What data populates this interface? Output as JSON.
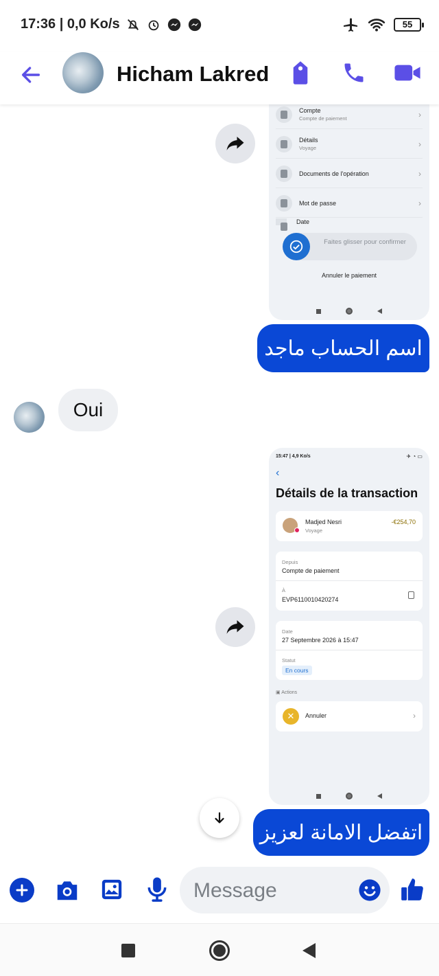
{
  "status_bar": {
    "time_speed": "17:36 | 0,0 Ko/s",
    "battery": "55"
  },
  "header": {
    "contact_name": "Hicham Lakred"
  },
  "shared_screenshot_1": {
    "rows": [
      {
        "title": "Compte",
        "subtitle": "Compte de paiement"
      },
      {
        "title": "Détails",
        "subtitle": "Voyage"
      },
      {
        "title": "Documents de l'opération",
        "subtitle": ""
      },
      {
        "title": "Mot de passe",
        "subtitle": ""
      },
      {
        "title": "Date",
        "subtitle": ""
      }
    ],
    "slide_text": "Faites glisser pour confirmer",
    "cancel_payment": "Annuler le paiement"
  },
  "messages": {
    "outgoing_1": "اسم الحساب ماجد",
    "incoming_1": "Oui",
    "outgoing_2": "اتفضل الامانة لعزيز"
  },
  "shared_screenshot_2": {
    "status": "15:47 | 4,9 Ko/s",
    "title": "Détails de la transaction",
    "recipient_name": "Madjed Nesri",
    "recipient_sub": "Voyage",
    "amount": "-€254,70",
    "from_label": "Depuis",
    "from_value": "Compte de paiement",
    "to_label": "À",
    "to_value": "EVP6110010420274",
    "date_label": "Date",
    "date_value": "27 Septembre 2026  à 15:47",
    "status_label": "Statut",
    "status_value": "En cours",
    "actions_label": "Actions",
    "cancel_label": "Annuler"
  },
  "composer": {
    "placeholder": "Message"
  },
  "colors": {
    "accent": "#5b4fe6",
    "outgoing_bubble": "#0a48d6",
    "composer_icons": "#0a3cc7"
  }
}
